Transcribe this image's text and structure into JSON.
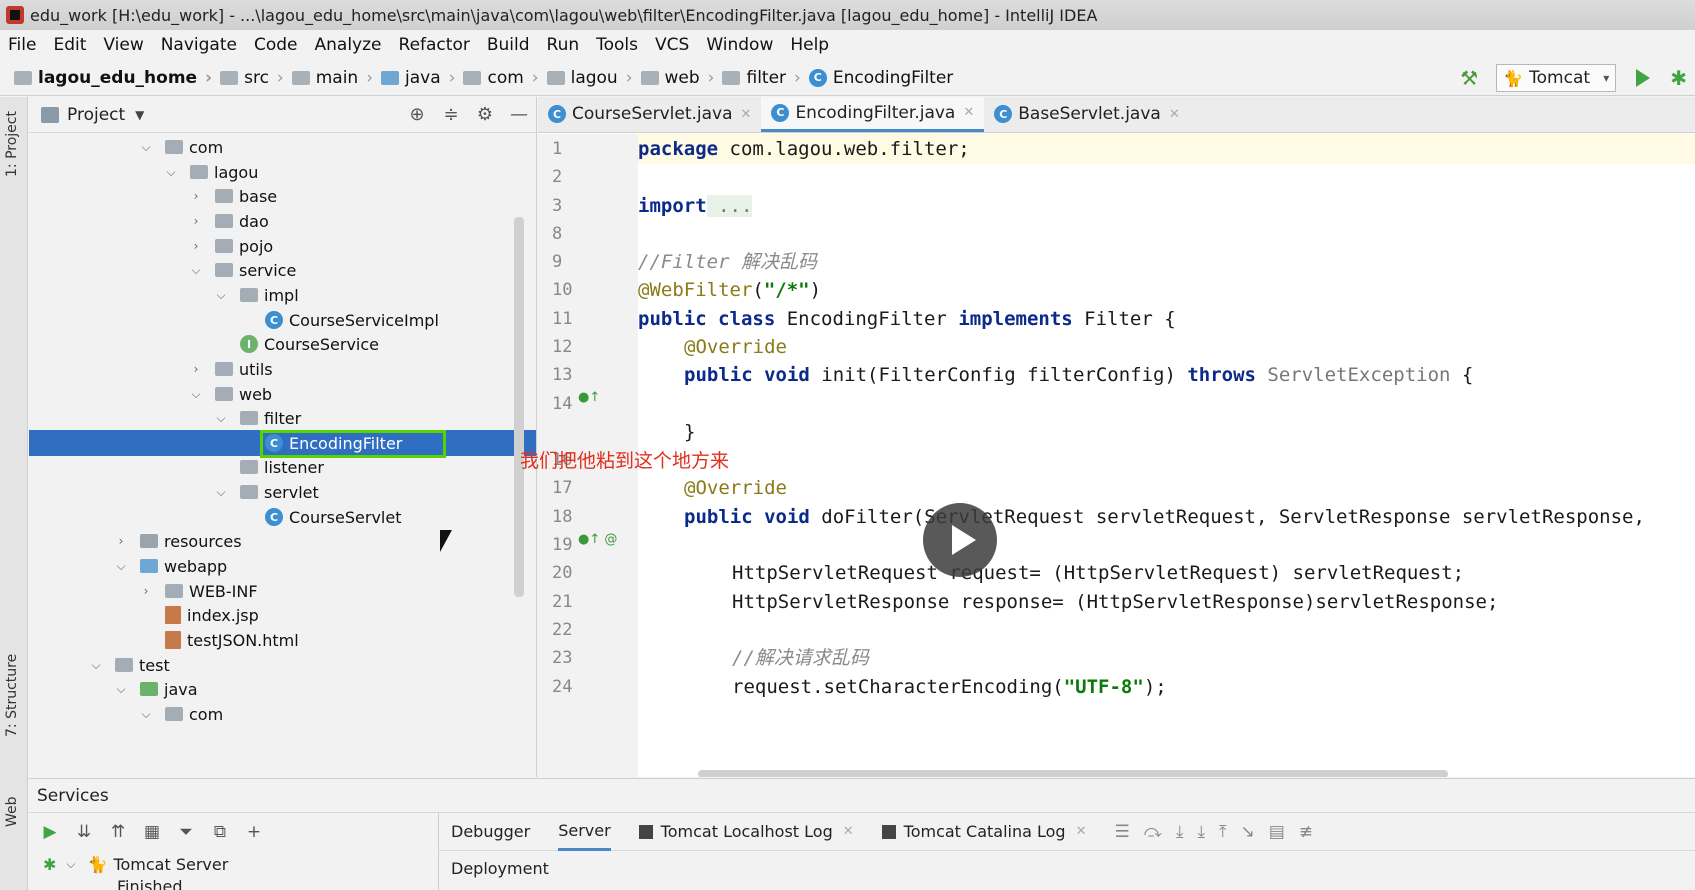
{
  "window": {
    "title": "edu_work [H:\\edu_work] - ...\\lagou_edu_home\\src\\main\\java\\com\\lagou\\web\\filter\\EncodingFilter.java [lagou_edu_home] - IntelliJ IDEA"
  },
  "menu": [
    "File",
    "Edit",
    "View",
    "Navigate",
    "Code",
    "Analyze",
    "Refactor",
    "Build",
    "Run",
    "Tools",
    "VCS",
    "Window",
    "Help"
  ],
  "breadcrumb": [
    "lagou_edu_home",
    "src",
    "main",
    "java",
    "com",
    "lagou",
    "web",
    "filter",
    "EncodingFilter"
  ],
  "run_config": {
    "label": "Tomcat"
  },
  "left_strip": {
    "project": "1: Project",
    "structure": "7: Structure",
    "web": "Web"
  },
  "project_panel": {
    "title": "Project",
    "tree": [
      {
        "label": "com",
        "arrow": "⌵",
        "icon": "folder"
      },
      {
        "label": "lagou",
        "arrow": "⌵",
        "icon": "folder"
      },
      {
        "label": "base",
        "arrow": "›",
        "icon": "folder"
      },
      {
        "label": "dao",
        "arrow": "›",
        "icon": "folder"
      },
      {
        "label": "pojo",
        "arrow": "›",
        "icon": "folder"
      },
      {
        "label": "service",
        "arrow": "⌵",
        "icon": "folder"
      },
      {
        "label": "impl",
        "arrow": "⌵",
        "icon": "folder"
      },
      {
        "label": "CourseServiceImpl",
        "arrow": "",
        "icon": "class"
      },
      {
        "label": "CourseService",
        "arrow": "",
        "icon": "interface"
      },
      {
        "label": "utils",
        "arrow": "›",
        "icon": "folder"
      },
      {
        "label": "web",
        "arrow": "⌵",
        "icon": "folder"
      },
      {
        "label": "filter",
        "arrow": "⌵",
        "icon": "folder"
      },
      {
        "label": "EncodingFilter",
        "arrow": "",
        "icon": "class"
      },
      {
        "label": "listener",
        "arrow": "",
        "icon": "folder"
      },
      {
        "label": "servlet",
        "arrow": "⌵",
        "icon": "folder"
      },
      {
        "label": "CourseServlet",
        "arrow": "",
        "icon": "class"
      },
      {
        "label": "resources",
        "arrow": "›",
        "icon": "folder-res"
      },
      {
        "label": "webapp",
        "arrow": "⌵",
        "icon": "folder-web"
      },
      {
        "label": "WEB-INF",
        "arrow": "›",
        "icon": "folder"
      },
      {
        "label": "index.jsp",
        "arrow": "",
        "icon": "file"
      },
      {
        "label": "testJSON.html",
        "arrow": "",
        "icon": "file"
      },
      {
        "label": "test",
        "arrow": "⌵",
        "icon": "folder"
      },
      {
        "label": "java",
        "arrow": "⌵",
        "icon": "folder-src"
      },
      {
        "label": "com",
        "arrow": "⌵",
        "icon": "folder"
      }
    ]
  },
  "editor": {
    "tabs": [
      {
        "label": "CourseServlet.java",
        "active": false
      },
      {
        "label": "EncodingFilter.java",
        "active": true
      },
      {
        "label": "BaseServlet.java",
        "active": false
      }
    ],
    "line_numbers": [
      "1",
      "2",
      "3",
      "8",
      "9",
      "10",
      "11",
      "12",
      "13",
      "14",
      "",
      "16",
      "17",
      "18",
      "19",
      "20",
      "21",
      "22",
      "23",
      "24"
    ],
    "code": {
      "l1_kw": "package",
      "l1_rest": " com.lagou.web.filter;",
      "l3_kw": "import",
      "l3_rest": " ...",
      "l9": "//Filter 解决乱码",
      "l10_an": "@WebFilter",
      "l10_p1": "(",
      "l10_st": "\"/*\"",
      "l10_p2": ")",
      "l11_kw1": "public class",
      "l11_mid": " EncodingFilter ",
      "l11_kw2": "implements",
      "l11_rest": " Filter {",
      "l12_an": "@Override",
      "l13_kw": "public void",
      "l13_mid": " init(FilterConfig filterConfig) ",
      "l13_kw2": "throws",
      "l13_gr": " ServletException",
      "l13_rest": " {",
      "l15": "}",
      "l17_an": "@Override",
      "l18_kw": "public void",
      "l18_rest": " doFilter(ServletRequest servletRequest, ServletResponse servletResponse,",
      "l20": "HttpServletRequest request= (HttpServletRequest) servletRequest;",
      "l21": "HttpServletResponse response= (HttpServletResponse)servletResponse;",
      "l23": "//解决请求乱码",
      "l24_a": "request.setCharacterEncoding(",
      "l24_st": "\"UTF-8\"",
      "l24_b": ");"
    }
  },
  "overlay_caption": "我们把他粘到这个地方来",
  "services": {
    "title": "Services",
    "tree": [
      "Tomcat Server",
      "Finished"
    ],
    "tabs": [
      {
        "label": "Debugger",
        "active": false
      },
      {
        "label": "Server",
        "active": true
      },
      {
        "label": "Tomcat Localhost Log",
        "active": false
      },
      {
        "label": "Tomcat Catalina Log",
        "active": false
      }
    ],
    "deployment_label": "Deployment"
  }
}
